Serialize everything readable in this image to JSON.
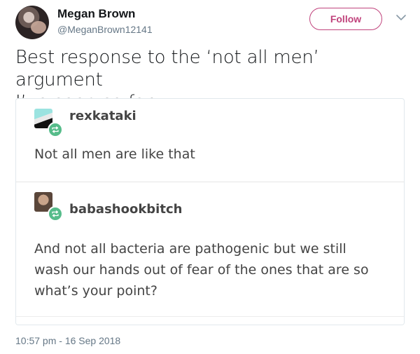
{
  "user": {
    "display_name": "Megan Brown",
    "handle": "@MeganBrown12141"
  },
  "follow_button": {
    "label": "Follow"
  },
  "tweet": {
    "text_line1": "Best response to the ‘not all men’ argument",
    "text_line2": "I’ve seen so far",
    "timestamp": "10:57 pm - 16 Sep 2018"
  },
  "media": {
    "posts": [
      {
        "username": "rexkataki",
        "body": "Not all men are like that"
      },
      {
        "username": "babashookbitch",
        "body": "And not all bacteria are pathogenic but we still wash our hands out of fear of the ones that are so what’s your point?"
      }
    ]
  },
  "colors": {
    "follow_accent": "#c0437c",
    "reblog_green": "#56bc8a",
    "secondary_text": "#657786"
  }
}
